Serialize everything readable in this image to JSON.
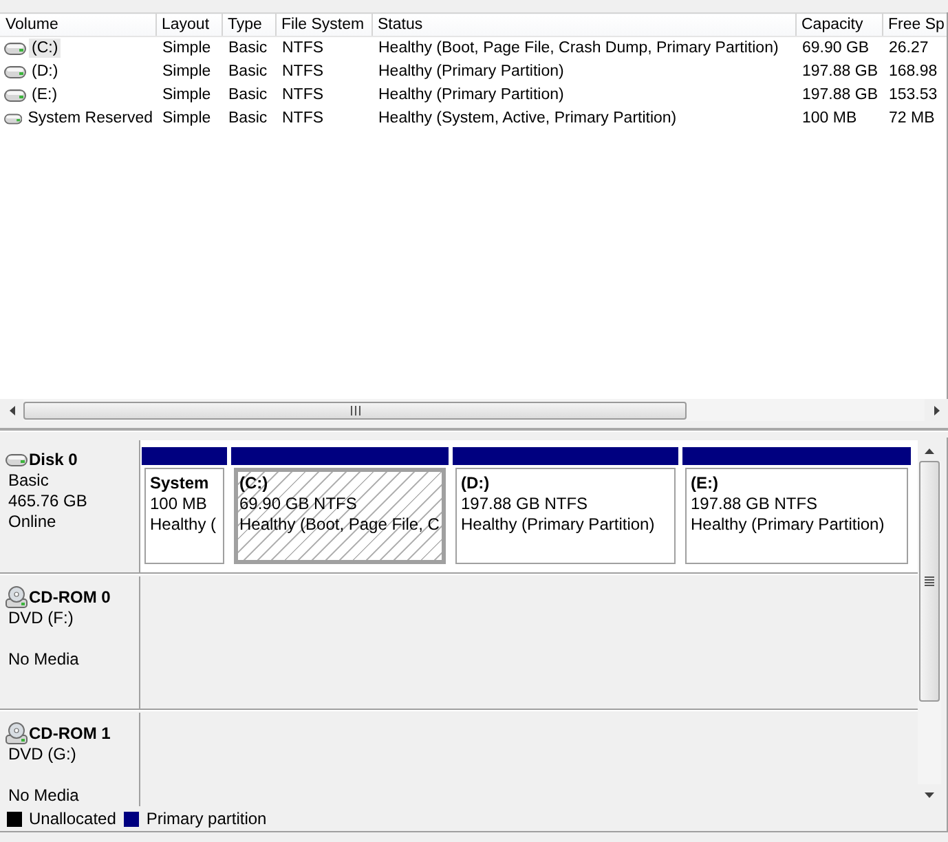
{
  "volume_list": {
    "columns": [
      "Volume",
      "Layout",
      "Type",
      "File System",
      "Status",
      "Capacity",
      "Free Sp"
    ],
    "rows": [
      {
        "selected": true,
        "cells": [
          "(C:)",
          "Simple",
          "Basic",
          "NTFS",
          "Healthy (Boot, Page File, Crash Dump, Primary Partition)",
          "69.90 GB",
          "26.27"
        ]
      },
      {
        "selected": false,
        "cells": [
          "(D:)",
          "Simple",
          "Basic",
          "NTFS",
          "Healthy (Primary Partition)",
          "197.88 GB",
          "168.98"
        ]
      },
      {
        "selected": false,
        "cells": [
          "(E:)",
          "Simple",
          "Basic",
          "NTFS",
          "Healthy (Primary Partition)",
          "197.88 GB",
          "153.53"
        ]
      },
      {
        "selected": false,
        "cells": [
          "System Reserved",
          "Simple",
          "Basic",
          "NTFS",
          "Healthy (System, Active, Primary Partition)",
          "100 MB",
          "72 MB"
        ]
      }
    ]
  },
  "disks": [
    {
      "kind": "disk",
      "name": "Disk 0",
      "details": [
        "Basic",
        "465.76 GB",
        "Online"
      ],
      "partitions": [
        {
          "name": "System",
          "size": "100 MB",
          "status": "Healthy (",
          "selected": false
        },
        {
          "name": "(C:)",
          "size": "69.90 GB NTFS",
          "status": "Healthy (Boot, Page File, C",
          "selected": true
        },
        {
          "name": "(D:)",
          "size": "197.88 GB NTFS",
          "status": "Healthy (Primary Partition)",
          "selected": false
        },
        {
          "name": "(E:)",
          "size": "197.88 GB NTFS",
          "status": "Healthy (Primary Partition)",
          "selected": false
        }
      ]
    },
    {
      "kind": "cdrom",
      "name": "CD-ROM 0",
      "details": [
        "DVD (F:)",
        "No Media"
      ]
    },
    {
      "kind": "cdrom",
      "name": "CD-ROM 1",
      "details": [
        "DVD (G:)",
        "No Media"
      ]
    }
  ],
  "legend": [
    {
      "label": "Unallocated",
      "color": "#000000"
    },
    {
      "label": "Primary partition",
      "color": "#000080"
    }
  ]
}
